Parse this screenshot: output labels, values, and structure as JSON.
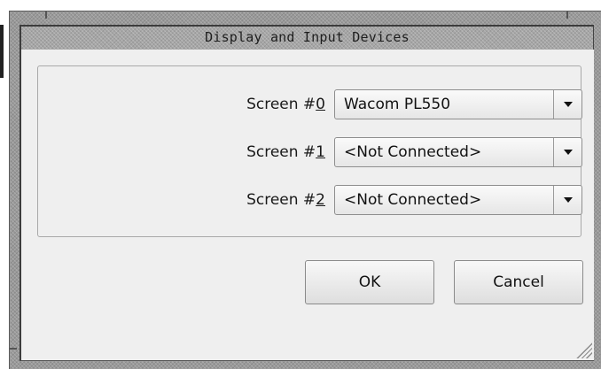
{
  "window": {
    "title": "Display and Input Devices"
  },
  "screens": [
    {
      "label_prefix": "Screen #",
      "mnemonic": "0",
      "value": "Wacom PL550"
    },
    {
      "label_prefix": "Screen #",
      "mnemonic": "1",
      "value": "<Not Connected>"
    },
    {
      "label_prefix": "Screen #",
      "mnemonic": "2",
      "value": "<Not Connected>"
    }
  ],
  "buttons": {
    "ok": "OK",
    "cancel": "Cancel"
  },
  "icons": {
    "combo_arrow": "chevron-down-icon",
    "resize_grip": "resize-grip-icon"
  }
}
